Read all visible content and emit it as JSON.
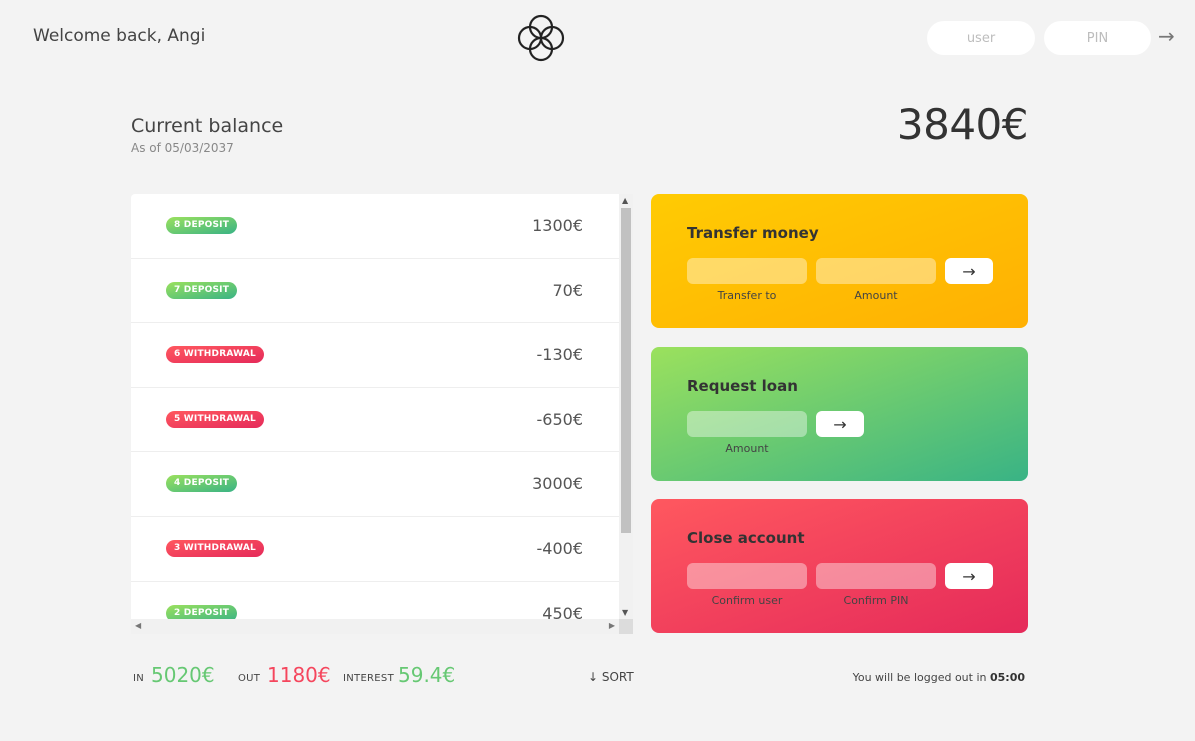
{
  "nav": {
    "welcome": "Welcome back, Angi",
    "login_user_placeholder": "user",
    "login_pin_placeholder": "PIN",
    "login_arrow": "→"
  },
  "balance": {
    "label": "Current balance",
    "date": "As of 05/03/2037",
    "value": "3840€"
  },
  "movements": [
    {
      "label": "8 DEPOSIT",
      "kind": "deposit",
      "value": "1300€"
    },
    {
      "label": "7 DEPOSIT",
      "kind": "deposit",
      "value": "70€"
    },
    {
      "label": "6 WITHDRAWAL",
      "kind": "withdrawal",
      "value": "-130€"
    },
    {
      "label": "5 WITHDRAWAL",
      "kind": "withdrawal",
      "value": "-650€"
    },
    {
      "label": "4 DEPOSIT",
      "kind": "deposit",
      "value": "3000€"
    },
    {
      "label": "3 WITHDRAWAL",
      "kind": "withdrawal",
      "value": "-400€"
    },
    {
      "label": "2 DEPOSIT",
      "kind": "deposit",
      "value": "450€"
    }
  ],
  "operations": {
    "transfer": {
      "title": "Transfer money",
      "label_to": "Transfer to",
      "label_amount": "Amount",
      "button": "→"
    },
    "loan": {
      "title": "Request loan",
      "label_amount": "Amount",
      "button": "→"
    },
    "close": {
      "title": "Close account",
      "label_user": "Confirm user",
      "label_pin": "Confirm PIN",
      "button": "→"
    }
  },
  "summary": {
    "in_label": "IN",
    "in_value": "5020€",
    "out_label": "OUT",
    "out_value": "1180€",
    "interest_label": "INTEREST",
    "interest_value": "59.4€",
    "sort_label": "↓ SORT"
  },
  "logout": {
    "text": "You will be logged out in ",
    "time": "05:00"
  },
  "colors": {
    "deposit": "#66c873",
    "withdrawal": "#f5465d",
    "transfer": "#ffb003",
    "loan": "#39b385",
    "close": "#e52a5a"
  }
}
